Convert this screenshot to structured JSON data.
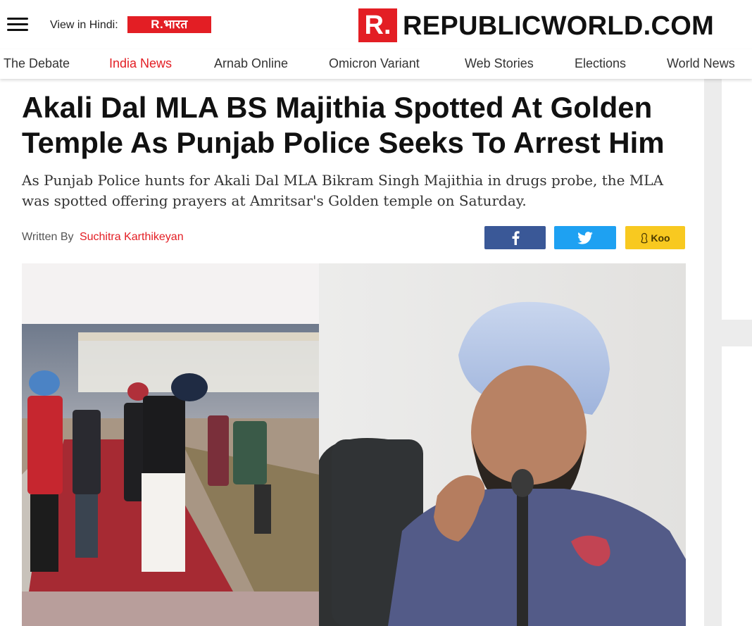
{
  "header": {
    "hindi_label": "View in Hindi:",
    "hindi_logo": "R.भारत",
    "brand_mark": "R.",
    "brand_name": "REPUBLICWORLD.COM"
  },
  "nav": {
    "items": [
      "The Debate",
      "India News",
      "Arnab Online",
      "Omicron Variant",
      "Web Stories",
      "Elections",
      "World News"
    ],
    "active": "India News"
  },
  "article": {
    "headline": "Akali Dal MLA BS Majithia Spotted At Golden Temple As Punjab Police Seeks To Arrest Him",
    "summary": "As Punjab Police hunts for Akali Dal MLA Bikram Singh Majithia in drugs probe, the MLA was spotted offering prayers at Amritsar's Golden temple on Saturday.",
    "byline_prefix": "Written By",
    "author": "Suchitra Karthikeyan"
  },
  "share": {
    "facebook_icon": "facebook-icon",
    "twitter_icon": "twitter-icon",
    "koo_label": "Koo"
  },
  "colors": {
    "brand_red": "#e31e24",
    "facebook": "#3a5897",
    "twitter": "#1ea1f2",
    "koo": "#f8c920"
  }
}
